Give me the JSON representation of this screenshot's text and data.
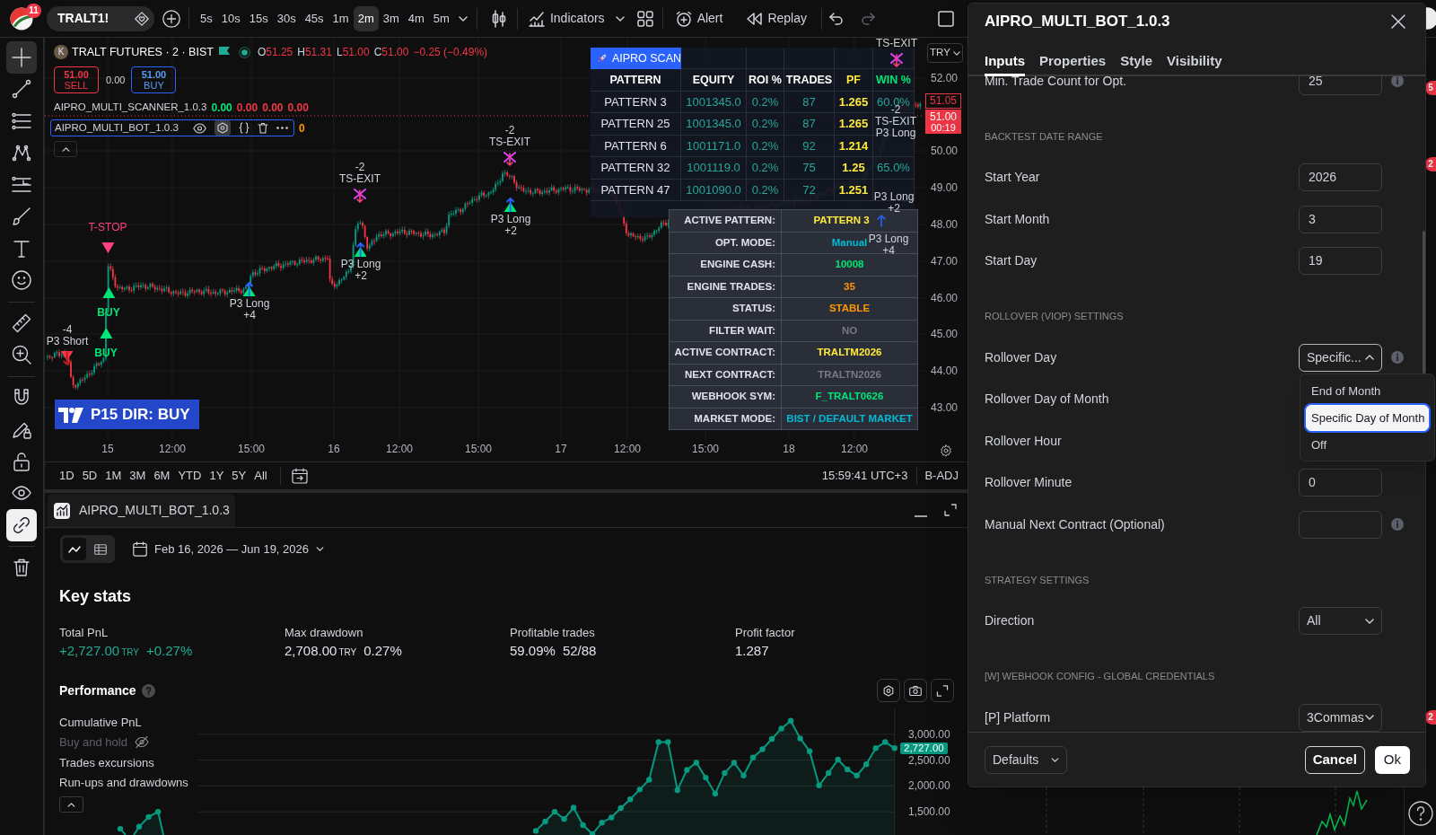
{
  "top_bar": {
    "logo_badge": "11",
    "symbol": "TRALT1!",
    "intervals": [
      {
        "label": "5s",
        "selected": false
      },
      {
        "label": "10s",
        "selected": false
      },
      {
        "label": "15s",
        "selected": false
      },
      {
        "label": "30s",
        "selected": false
      },
      {
        "label": "45s",
        "selected": false
      },
      {
        "label": "1m",
        "selected": false
      },
      {
        "label": "2m",
        "selected": true
      },
      {
        "label": "3m",
        "selected": false
      },
      {
        "label": "4m",
        "selected": false
      },
      {
        "label": "5m",
        "selected": false
      }
    ],
    "indicators": "Indicators",
    "alert": "Alert",
    "replay": "Replay"
  },
  "left_toolbar": [
    {
      "kind": "crosshair",
      "selected": true
    },
    {
      "kind": "trend-line",
      "selected": false
    },
    {
      "kind": "lines",
      "selected": false
    },
    {
      "kind": "pattern",
      "selected": false
    },
    {
      "kind": "projection",
      "selected": false
    },
    {
      "kind": "brush",
      "selected": false
    },
    {
      "kind": "text",
      "selected": false
    },
    {
      "kind": "emoji",
      "selected": false
    },
    {
      "kind": "ruler",
      "selected": false
    },
    {
      "kind": "zoom",
      "selected": false
    },
    {
      "kind": "magnet",
      "selected": false
    },
    {
      "kind": "draw-lock",
      "selected": false
    },
    {
      "kind": "lock",
      "selected": false
    },
    {
      "kind": "eye",
      "selected": false
    },
    {
      "kind": "link",
      "selected": true
    },
    {
      "kind": "trash",
      "selected": false
    }
  ],
  "chart": {
    "header": {
      "initial": "K",
      "title": "TRALT FUTURES · 2 · BIST",
      "ohlc": [
        {
          "label": "O",
          "value": "51.25"
        },
        {
          "label": "H",
          "value": "51.31"
        },
        {
          "label": "L",
          "value": "51.00"
        },
        {
          "label": "C",
          "value": "51.00"
        }
      ],
      "change": "−0.25 (−0.49%)"
    },
    "order_panel": {
      "sell_price": "51.00",
      "sell_label": "SELL",
      "spread": "0.00",
      "buy_price": "51.00",
      "buy_label": "BUY"
    },
    "studies": [
      {
        "name": "AIPRO_MULTI_SCANNER_1.0.3",
        "selected": false,
        "values": [
          {
            "text": "0.00",
            "color": "#00e676"
          },
          {
            "text": "0.00",
            "color": "#f23645"
          },
          {
            "text": "0.00",
            "color": "#f23645"
          },
          {
            "text": "0.00",
            "color": "#f23645"
          }
        ]
      },
      {
        "name": "AIPRO_MULTI_BOT_1.0.3",
        "selected": true,
        "values": [
          {
            "text": "0",
            "color": "#ff9800"
          }
        ]
      }
    ],
    "signals": [
      {
        "kind": "short",
        "labels": [
          "-4",
          "P3 Short"
        ]
      },
      {
        "kind": "stop",
        "labels": [
          "T-STOP"
        ]
      },
      {
        "kind": "buy",
        "labels": [
          "BUY"
        ]
      },
      {
        "kind": "buy",
        "labels": [
          "BUY"
        ]
      },
      {
        "kind": "long",
        "labels": [
          "P3 Long",
          "+4"
        ]
      },
      {
        "kind": "exit",
        "labels": [
          "-2",
          "TS-EXIT"
        ]
      },
      {
        "kind": "long",
        "labels": [
          "P3 Long",
          "+2"
        ]
      },
      {
        "kind": "exit",
        "labels": [
          "-2",
          "TS-EXIT"
        ]
      },
      {
        "kind": "long",
        "labels": [
          "P3 Long",
          "+2"
        ]
      },
      {
        "kind": "exit",
        "labels": [
          "TS-EXIT"
        ]
      },
      {
        "kind": "tag",
        "labels": [
          "-2",
          "TS-EXIT",
          "P3 Long"
        ]
      },
      {
        "kind": "tag",
        "labels": [
          "P3 Long",
          "+2"
        ]
      },
      {
        "kind": "tag",
        "labels": [
          "P3 Long",
          "+4"
        ]
      }
    ],
    "direction_banner": "P15 DIR: BUY",
    "scanner": {
      "title": "AIPRO SCAN",
      "columns": [
        "PATTERN",
        "EQUITY",
        "ROI %",
        "TRADES",
        "PF",
        "WIN %"
      ],
      "rows": [
        {
          "pattern": "PATTERN 3",
          "equity": "1001345.0",
          "roi": "0.2%",
          "trades": "87",
          "pf": "1.265",
          "win": "60.0%"
        },
        {
          "pattern": "PATTERN 25",
          "equity": "1001345.0",
          "roi": "0.2%",
          "trades": "87",
          "pf": "1.265"
        },
        {
          "pattern": "PATTERN 6",
          "equity": "1001171.0",
          "roi": "0.2%",
          "trades": "92",
          "pf": "1.214"
        },
        {
          "pattern": "PATTERN 32",
          "equity": "1001119.0",
          "roi": "0.2%",
          "trades": "75",
          "pf": "1.25",
          "win": "65.0%"
        },
        {
          "pattern": "PATTERN 47",
          "equity": "1001090.0",
          "roi": "0.2%",
          "trades": "72",
          "pf": "1.251"
        }
      ]
    },
    "status_table": [
      {
        "label": "ACTIVE PATTERN:",
        "value": "PATTERN 3",
        "color": "#ffeb3b",
        "arrow": true
      },
      {
        "label": "OPT. MODE:",
        "value": "Manual",
        "color": "#00bcd4",
        "arrow": false
      },
      {
        "label": "ENGINE CASH:",
        "value": "10008",
        "color": "#00e676",
        "arrow": false
      },
      {
        "label": "ENGINE TRADES:",
        "value": "35",
        "color": "#ff9800",
        "arrow": false
      },
      {
        "label": "STATUS:",
        "value": "STABLE",
        "color": "#ff9800",
        "arrow": false
      },
      {
        "label": "FILTER WAIT:",
        "value": "NO",
        "color": "#787b86",
        "arrow": false
      },
      {
        "label": "ACTIVE CONTRACT:",
        "value": "TRALTM2026",
        "color": "#ffeb3b",
        "arrow": false
      },
      {
        "label": "NEXT CONTRACT:",
        "value": "TRALTN2026",
        "color": "#787b86",
        "arrow": false
      },
      {
        "label": "WEBHOOK SYM:",
        "value": "F_TRALT0626",
        "color": "#00e676",
        "arrow": false
      },
      {
        "label": "MARKET MODE:",
        "value": "BIST / DEFAULT MARKET",
        "color": "#00bcd4",
        "arrow": false
      }
    ],
    "price_axis": {
      "currency": "TRY",
      "labels": [
        "52.00",
        "50.00",
        "49.00",
        "48.00",
        "47.00",
        "46.00",
        "45.00",
        "44.00",
        "43.00"
      ],
      "high_marker": "51.05",
      "last_price": "51.00",
      "countdown": "00:19"
    },
    "time_axis": [
      "15",
      "12:00",
      "15:00",
      "16",
      "12:00",
      "15:00",
      "17",
      "12:00",
      "15:00",
      "18",
      "12:00"
    ],
    "range_bar": {
      "ranges": [
        "1D",
        "5D",
        "1M",
        "3M",
        "6M",
        "YTD",
        "1Y",
        "5Y",
        "All"
      ],
      "clock": "15:59:41 UTC+3",
      "adjustment": "B-ADJ"
    }
  },
  "strategy_panel": {
    "tab": "AIPRO_MULTI_BOT_1.0.3",
    "views": [
      {
        "kind": "chart",
        "selected": true
      },
      {
        "kind": "table",
        "selected": false
      }
    ],
    "date_range": "Feb 16, 2026 — Jun 19, 2026",
    "heading": "Key stats",
    "stats": [
      {
        "label": "Total PnL",
        "value": "+2,727.00",
        "unit": "TRY",
        "change": "+0.27%",
        "positive": true
      },
      {
        "label": "Max drawdown",
        "value": "2,708.00",
        "unit": "TRY",
        "change": "0.27%",
        "positive": false
      },
      {
        "label": "Profitable trades",
        "value": "59.09%",
        "change": "52/88",
        "positive": false
      },
      {
        "label": "Profit factor",
        "value": "1.287",
        "positive": false
      }
    ],
    "performance_title": "Performance",
    "legend": [
      {
        "label": "Cumulative PnL",
        "visible": true
      },
      {
        "label": "Buy and hold",
        "visible": false
      },
      {
        "label": "Trades excursions",
        "visible": true
      },
      {
        "label": "Run-ups and drawdowns",
        "visible": true
      }
    ],
    "chart_data": {
      "type": "area",
      "grid": true,
      "series": [
        {
          "color": "#089981",
          "values": [
            1130,
            1310,
            1500,
            1360,
            1580,
            1240,
            1070,
            1290,
            1390,
            1570,
            1740,
            1930,
            2120,
            2850,
            2850,
            1920,
            2310,
            2450,
            2160,
            1850,
            2250,
            2450,
            2200,
            2550,
            2710,
            2910,
            3110,
            3260,
            2920,
            2670,
            2010,
            2250,
            2510,
            2320,
            2200,
            2420,
            2730,
            2850,
            2730
          ]
        }
      ],
      "ylim": [
        1050,
        3500
      ],
      "yticks": [
        {
          "value": 1500,
          "label": "1,500.00"
        },
        {
          "value": 2000,
          "label": "2,000.00"
        },
        {
          "value": 2500,
          "label": "2,500.00"
        },
        {
          "value": 3000,
          "label": "3,000.00"
        }
      ]
    },
    "last_value": "2,727.00"
  },
  "settings_dialog": {
    "title": "AIPRO_MULTI_BOT_1.0.3",
    "tabs": [
      {
        "label": "Inputs",
        "selected": true
      },
      {
        "label": "Properties",
        "selected": false
      },
      {
        "label": "Style",
        "selected": false
      },
      {
        "label": "Visibility",
        "selected": false
      }
    ],
    "inputs": [
      {
        "kind": "number",
        "label": "Min. Trade Count for Opt.",
        "value": "25",
        "info": true
      },
      {
        "kind": "section",
        "label": "BACKTEST DATE RANGE"
      },
      {
        "kind": "number",
        "label": "Start Year",
        "value": "2026",
        "info": false
      },
      {
        "kind": "number",
        "label": "Start Month",
        "value": "3",
        "info": false
      },
      {
        "kind": "number",
        "label": "Start Day",
        "value": "19",
        "info": false
      },
      {
        "kind": "section",
        "label": "ROLLOVER (VIOP) SETTINGS"
      },
      {
        "kind": "select",
        "label": "Rollover Day",
        "value": "Specific...",
        "expanded": true,
        "info": true,
        "options": [
          {
            "label": "End of Month",
            "selected": false
          },
          {
            "label": "Specific Day of Month",
            "selected": true
          },
          {
            "label": "Off",
            "selected": false
          }
        ]
      },
      {
        "kind": "label",
        "label": "Rollover Day of Month",
        "info": false
      },
      {
        "kind": "label",
        "label": "Rollover Hour",
        "info": false
      },
      {
        "kind": "number",
        "label": "Rollover Minute",
        "value": "0",
        "info": false
      },
      {
        "kind": "text",
        "label": "Manual Next Contract (Optional)",
        "info": true
      },
      {
        "kind": "section",
        "label": "STRATEGY SETTINGS"
      },
      {
        "kind": "select",
        "label": "Direction",
        "value": "All",
        "expanded": false,
        "info": false
      },
      {
        "kind": "section",
        "label": "[W] WEBHOOK CONFIG - GLOBAL CREDENTIALS"
      },
      {
        "kind": "select",
        "label": "[P] Platform",
        "value": "3Commas",
        "expanded": false,
        "info": false
      }
    ],
    "footer": {
      "defaults": "Defaults",
      "cancel": "Cancel",
      "ok": "Ok"
    }
  },
  "right_toolbar": {
    "badges": [
      "5",
      "2",
      "2"
    ]
  }
}
